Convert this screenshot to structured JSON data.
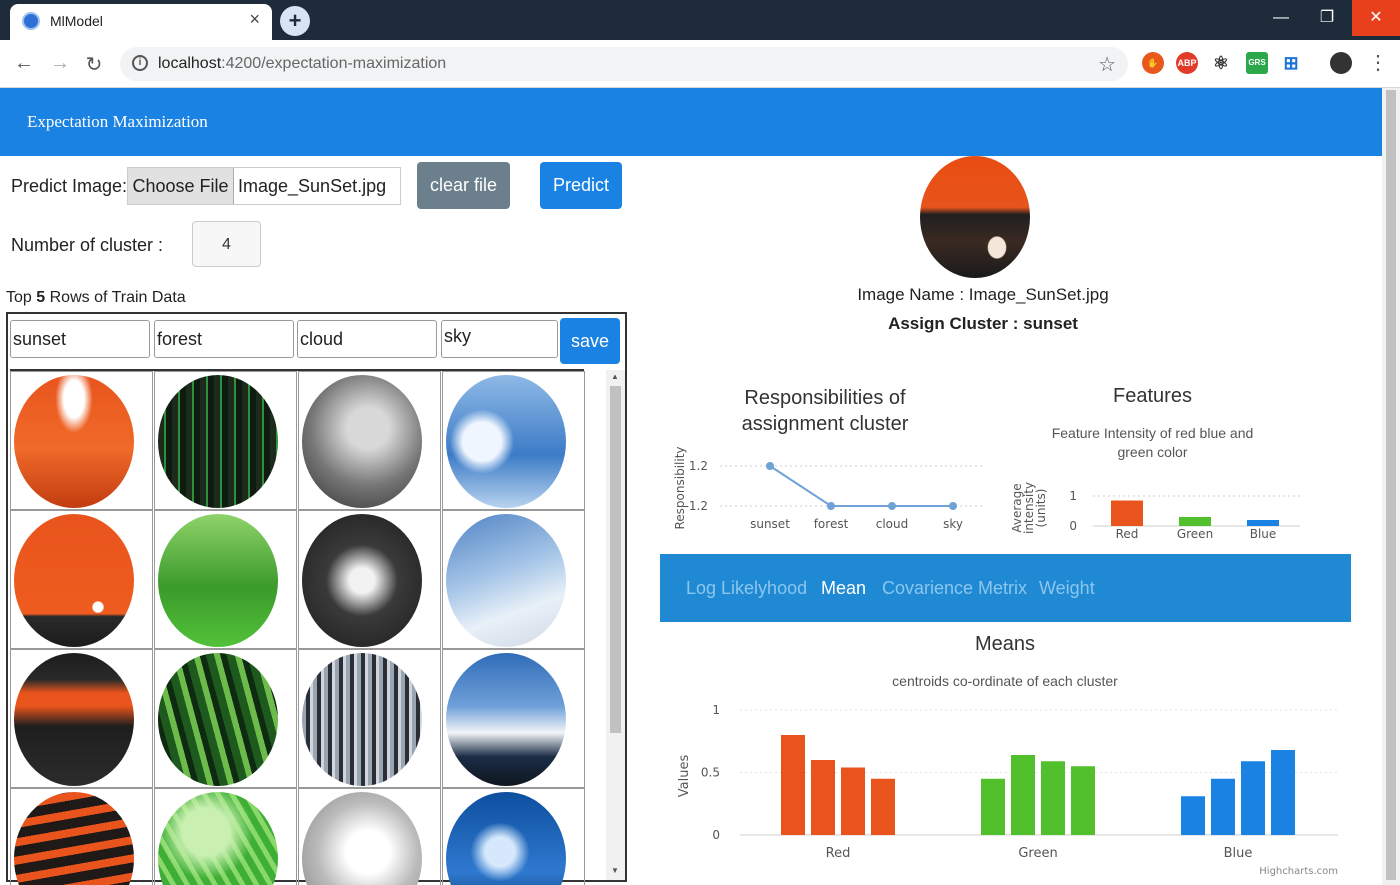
{
  "browser": {
    "tab_title": "MlModel",
    "url_host": "localhost",
    "url_path": ":4200/expectation-maximization",
    "ext_labels": [
      "ABP",
      "GRS"
    ]
  },
  "navbar": {
    "brand": "Expectation Maximization"
  },
  "form": {
    "predict_label": "Predict Image:",
    "choose_file": "Choose File",
    "file_name": "Image_SunSet.jpg",
    "clear_file": "clear file",
    "predict": "Predict",
    "cluster_label": "Number of cluster :",
    "cluster_value": "4"
  },
  "train": {
    "heading_prefix": "Top",
    "heading_count": "5",
    "heading_suffix": "Rows of Train Data",
    "categories": [
      "sunset",
      "forest",
      "cloud",
      "sky"
    ],
    "save": "save",
    "thumbnails": [
      [
        "sunset-icon",
        "forest-icon",
        "cloud-icon",
        "sky-icon"
      ],
      [
        "sunset-icon",
        "forest-icon",
        "cloud-icon",
        "sky-icon"
      ],
      [
        "sunset-icon",
        "forest-icon",
        "cloud-icon",
        "sky-icon"
      ],
      [
        "sunset-icon",
        "forest-icon",
        "cloud-icon",
        "sky-icon"
      ]
    ]
  },
  "prediction": {
    "image_name": "Image Name : Image_SunSet.jpg",
    "assign_cluster": "Assign Cluster : sunset"
  },
  "tabs": [
    "Log Likelyhood",
    "Mean",
    "Covarience Metrix",
    "Weight"
  ],
  "active_tab": "Mean",
  "credits": "Highcharts.com",
  "colors": {
    "primary": "#1a82e2",
    "tabs_bg": "#1f8ad3",
    "red": "#e8541c",
    "green": "#52bf2c",
    "blue": "#1a82e2",
    "line": "#6fa2d6"
  },
  "chart_data": [
    {
      "type": "line",
      "title_line1": "Responsibilities of",
      "title_line2": "assignment cluster",
      "ylabel": "Responsibility",
      "categories": [
        "sunset",
        "forest",
        "cloud",
        "sky"
      ],
      "values": [
        1.2,
        -1.2,
        -1.2,
        -1.2
      ],
      "yticks": [
        "1.2",
        "-1.2"
      ]
    },
    {
      "type": "bar",
      "title": "Features",
      "subtitle_line1": "Feature Intensity of red blue and",
      "subtitle_line2": "green color",
      "ylabel_line1": "Average",
      "ylabel_line2": "intensity",
      "ylabel_line3": "(units)",
      "categories": [
        "Red",
        "Green",
        "Blue"
      ],
      "values": [
        0.85,
        0.3,
        0.2
      ],
      "yticks": [
        "1",
        "0"
      ],
      "ylim": [
        0,
        1
      ]
    },
    {
      "type": "bar",
      "title": "Means",
      "subtitle": "centroids co-ordinate of each cluster",
      "ylabel": "Values",
      "categories": [
        "Red",
        "Green",
        "Blue"
      ],
      "series": [
        {
          "values": [
            0.8,
            0.45,
            0.31
          ]
        },
        {
          "values": [
            0.6,
            0.64,
            0.45
          ]
        },
        {
          "values": [
            0.54,
            0.59,
            0.59
          ]
        },
        {
          "values": [
            0.45,
            0.55,
            0.68
          ]
        }
      ],
      "yticks": [
        "1",
        "0.5",
        "0"
      ],
      "ylim": [
        0,
        1
      ]
    }
  ]
}
